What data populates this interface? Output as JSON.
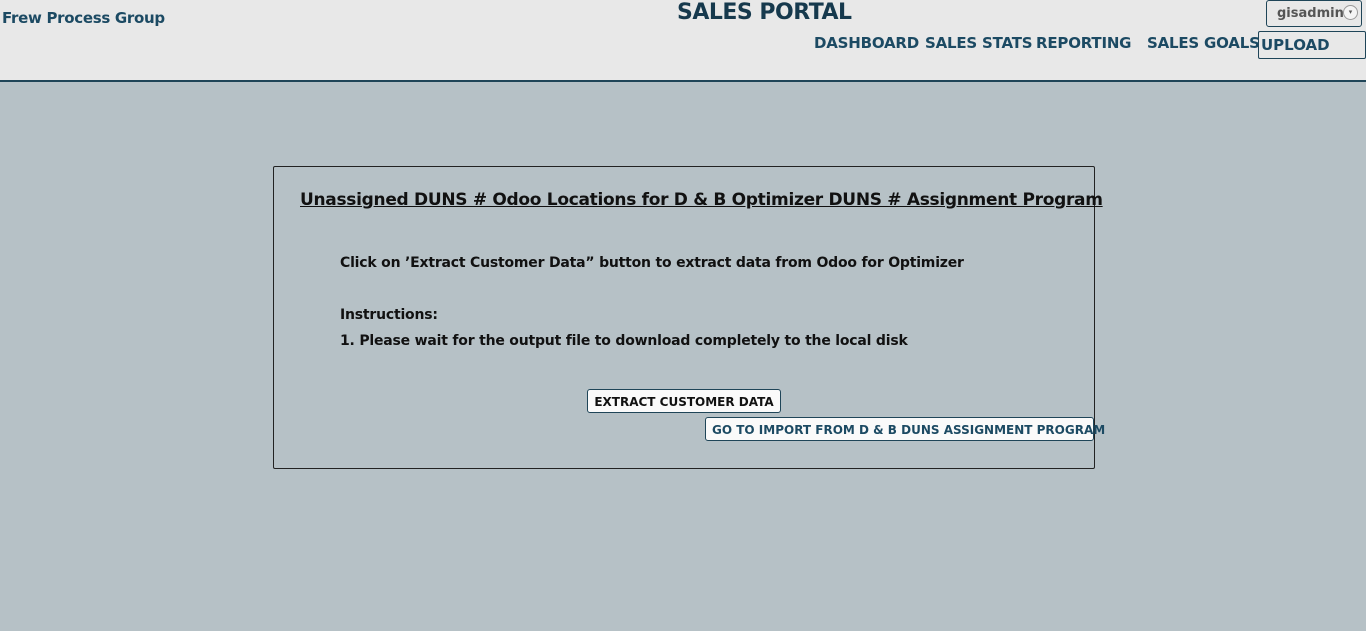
{
  "header": {
    "company": "Frew Process Group",
    "portal_title": "SALES PORTAL",
    "user": "gisadmin",
    "user_caret": "▾",
    "nav": {
      "dashboard": "DASHBOARD",
      "sales_stats": "SALES STATS",
      "reporting": "REPORTING",
      "sales_goals": "SALES GOALS",
      "upload": "UPLOAD"
    }
  },
  "panel": {
    "title": "Unassigned DUNS # Odoo Locations for D & B Optimizer DUNS # Assignment Program",
    "intro": "Click on ’Extract Customer Data” button to extract data from Odoo for Optimizer",
    "instructions_heading": "Instructions:",
    "instruction_1": "1. Please wait for the output file to download completely to the local disk",
    "extract_button": "EXTRACT CUSTOMER DATA",
    "import_button": "GO TO IMPORT FROM D & B DUNS ASSIGNMENT PROGRAM"
  },
  "colors": {
    "background": "#b6c1c6",
    "header_bg": "#e8e8e8",
    "accent": "#1c4a63"
  }
}
